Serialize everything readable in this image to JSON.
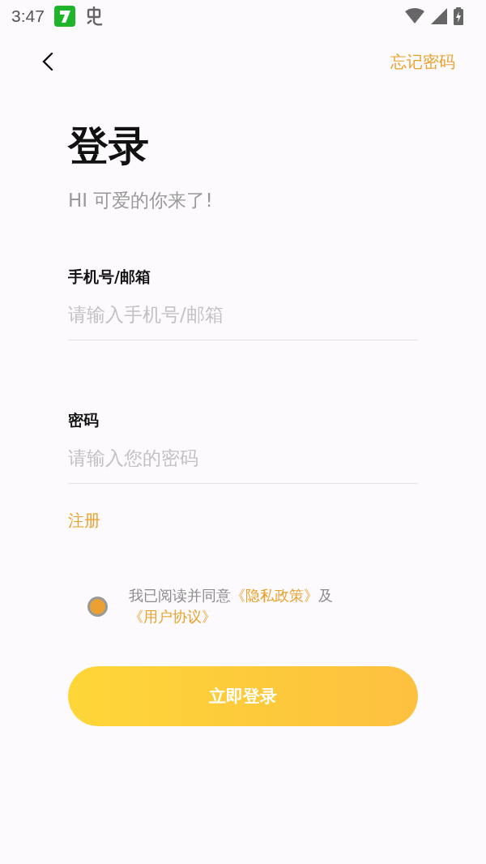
{
  "status_bar": {
    "time": "3:47"
  },
  "header": {
    "forgot_link": "忘记密码"
  },
  "title": "登录",
  "subtitle": "HI 可爱的你来了!",
  "fields": [
    {
      "label": "手机号/邮箱",
      "placeholder": "请输入手机号/邮箱"
    },
    {
      "label": "密码",
      "placeholder": "请输入您的密码"
    }
  ],
  "register_link": "注册",
  "agreement": {
    "checked": true,
    "parts": [
      {
        "kind": "plain",
        "text": "我已阅读并同意"
      },
      {
        "kind": "link",
        "text": "《隐私政策》"
      },
      {
        "kind": "plain",
        "text": "及"
      },
      {
        "kind": "link",
        "text": "《用户协议》"
      }
    ]
  },
  "login_button": "立即登录"
}
